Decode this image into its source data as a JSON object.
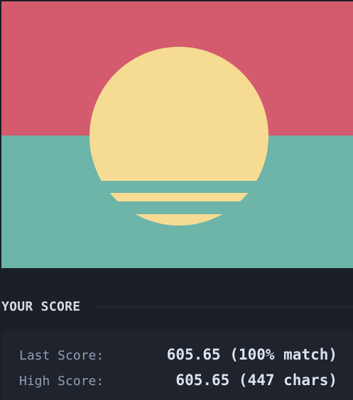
{
  "canvas": {
    "sky_color": "#d45b6d",
    "sea_color": "#6db4a9",
    "sun_color": "#f5dc92"
  },
  "score": {
    "title": "YOUR SCORE",
    "last_label": "Last Score:",
    "last_value": "605.65 (100% match)",
    "high_label": "High Score:",
    "high_value": "605.65 (447 chars)"
  }
}
